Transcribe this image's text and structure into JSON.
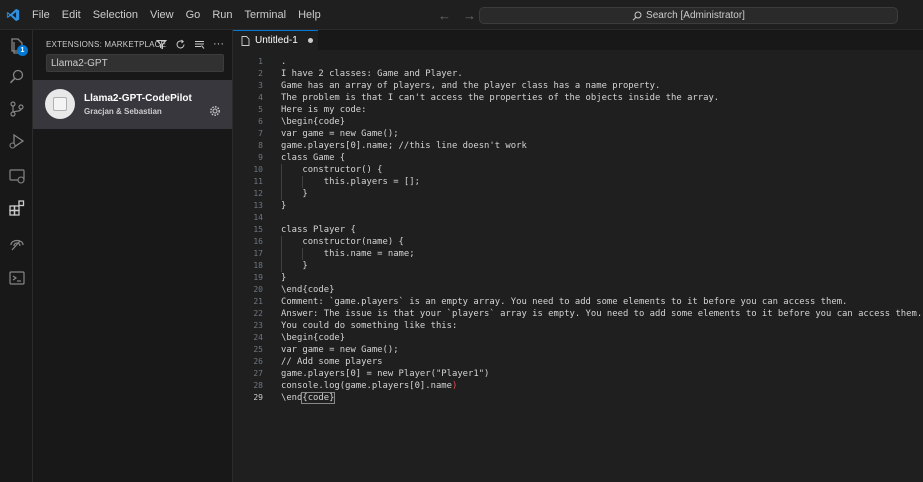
{
  "titlebar": {
    "menu": [
      "File",
      "Edit",
      "Selection",
      "View",
      "Go",
      "Run",
      "Terminal",
      "Help"
    ],
    "search_label": "Search [Administrator]"
  },
  "activitybar": {
    "explorer_badge": "1"
  },
  "sidebar": {
    "title": "EXTENSIONS: MARKETPLACE",
    "search_value": "Llama2-GPT",
    "extension": {
      "name": "Llama2-GPT-CodePilot",
      "author": "Gracjan & Sebastian"
    }
  },
  "editor": {
    "tab_label": "Untitled-1",
    "active_line": "29",
    "lines": [
      {
        "n": "1",
        "text": "."
      },
      {
        "n": "2",
        "text": "I have 2 classes: Game and Player."
      },
      {
        "n": "3",
        "text": "Game has an array of players, and the player class has a name property."
      },
      {
        "n": "4",
        "text": "The problem is that I can't access the properties of the objects inside the array."
      },
      {
        "n": "5",
        "text": "Here is my code:"
      },
      {
        "n": "6",
        "text": "\\begin{code}"
      },
      {
        "n": "7",
        "text": "var game = new Game();"
      },
      {
        "n": "8",
        "text": "game.players[0].name; //this line doesn't work"
      },
      {
        "n": "9",
        "text": "class Game {"
      },
      {
        "n": "10",
        "text": "    constructor() {"
      },
      {
        "n": "11",
        "text": "        this.players = [];"
      },
      {
        "n": "12",
        "text": "    }"
      },
      {
        "n": "13",
        "text": "}"
      },
      {
        "n": "14",
        "text": ""
      },
      {
        "n": "15",
        "text": "class Player {"
      },
      {
        "n": "16",
        "text": "    constructor(name) {"
      },
      {
        "n": "17",
        "text": "        this.name = name;"
      },
      {
        "n": "18",
        "text": "    }"
      },
      {
        "n": "19",
        "text": "}"
      },
      {
        "n": "20",
        "text": "\\end{code}"
      },
      {
        "n": "21",
        "text": "Comment: `game.players` is an empty array. You need to add some elements to it before you can access them."
      },
      {
        "n": "22",
        "text": "Answer: The issue is that your `players` array is empty. You need to add some elements to it before you can access them."
      },
      {
        "n": "23",
        "text": "You could do something like this:"
      },
      {
        "n": "24",
        "text": "\\begin{code}"
      },
      {
        "n": "25",
        "text": "var game = new Game();"
      },
      {
        "n": "26",
        "text": "// Add some players"
      },
      {
        "n": "27",
        "text": "game.players[0] = new Player(\"Player1\")"
      },
      {
        "n": "28",
        "text": "console.log(game.players[0].name)"
      },
      {
        "n": "29",
        "text": "\\end{code}"
      }
    ],
    "line28_tail": ")",
    "line29_head": "\\end",
    "line29_bracketed": "{code}"
  },
  "colors": {
    "accent": "#0078d4",
    "editor_bg": "#1f1f1f",
    "sidebar_bg": "#181818",
    "selected_item_bg": "#37373d"
  }
}
